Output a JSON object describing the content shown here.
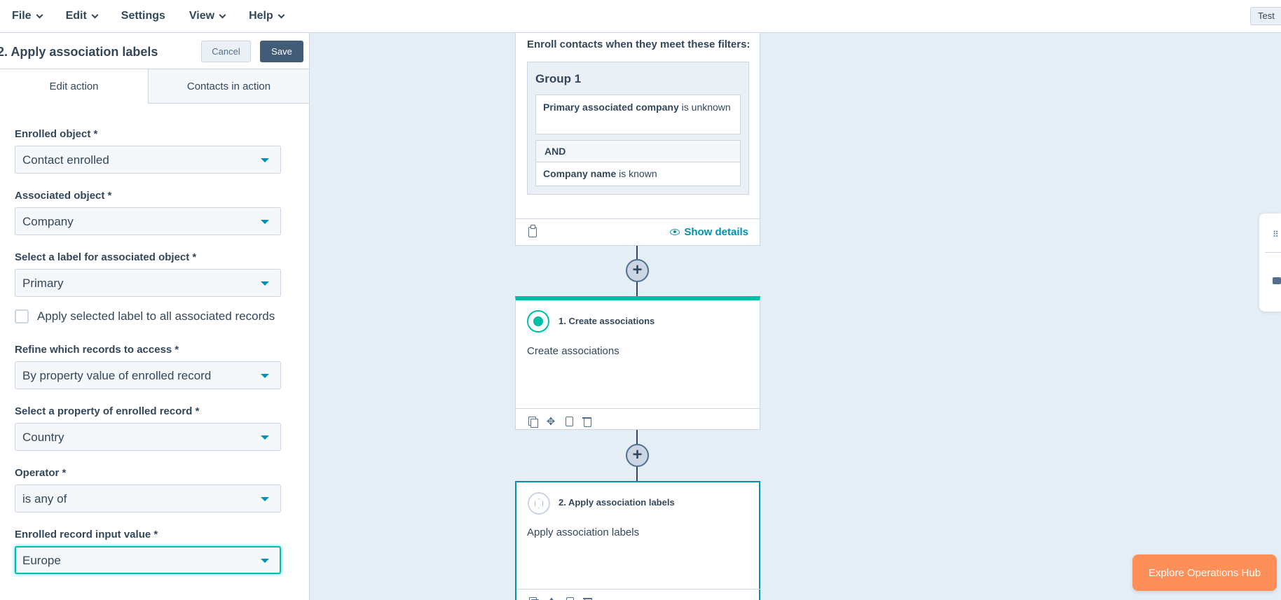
{
  "menubar": {
    "items": [
      {
        "label": "File",
        "has_dropdown": true
      },
      {
        "label": "Edit",
        "has_dropdown": true
      },
      {
        "label": "Settings",
        "has_dropdown": false
      },
      {
        "label": "View",
        "has_dropdown": true
      },
      {
        "label": "Help",
        "has_dropdown": true
      }
    ],
    "test_label": "Test"
  },
  "panel": {
    "title": "2. Apply association labels",
    "cancel_label": "Cancel",
    "save_label": "Save",
    "tabs": [
      {
        "label": "Edit action",
        "active": true
      },
      {
        "label": "Contacts in action",
        "active": false
      }
    ],
    "fields": {
      "enrolled_object": {
        "label": "Enrolled object *",
        "value": "Contact enrolled"
      },
      "associated_object": {
        "label": "Associated object *",
        "value": "Company"
      },
      "label_for_object": {
        "label": "Select a label for associated object *",
        "value": "Primary"
      },
      "refine_records": {
        "label": "Refine which records to access *",
        "value": "By property value of enrolled record"
      },
      "property": {
        "label": "Select a property of enrolled record *",
        "value": "Country"
      },
      "operator": {
        "label": "Operator *",
        "value": "is any of"
      },
      "input_value": {
        "label": "Enrolled record input value *",
        "value": "Europe"
      }
    },
    "apply_all_checkbox": {
      "label": "Apply selected label to all associated records",
      "checked": false
    }
  },
  "canvas": {
    "enroll_card": {
      "heading": "Enroll contacts when they meet these filters:",
      "group_title": "Group 1",
      "filter1_property": "Primary associated company",
      "filter1_rest": " is unknown",
      "and_label": "AND",
      "filter2_property": "Company name",
      "filter2_rest": " is known",
      "show_details": "Show details"
    },
    "action1": {
      "title": "1. Create associations",
      "description": "Create associations",
      "accent": "#00bda5"
    },
    "action2": {
      "title": "2. Apply association labels",
      "description": "Apply association labels",
      "accent": "#0091ae"
    }
  },
  "explore_button": "Explore Operations Hub",
  "colors": {
    "brand_teal": "#00bda5",
    "link": "#0091ae",
    "primary_button": "#425b76",
    "cta": "#ff8f59"
  }
}
